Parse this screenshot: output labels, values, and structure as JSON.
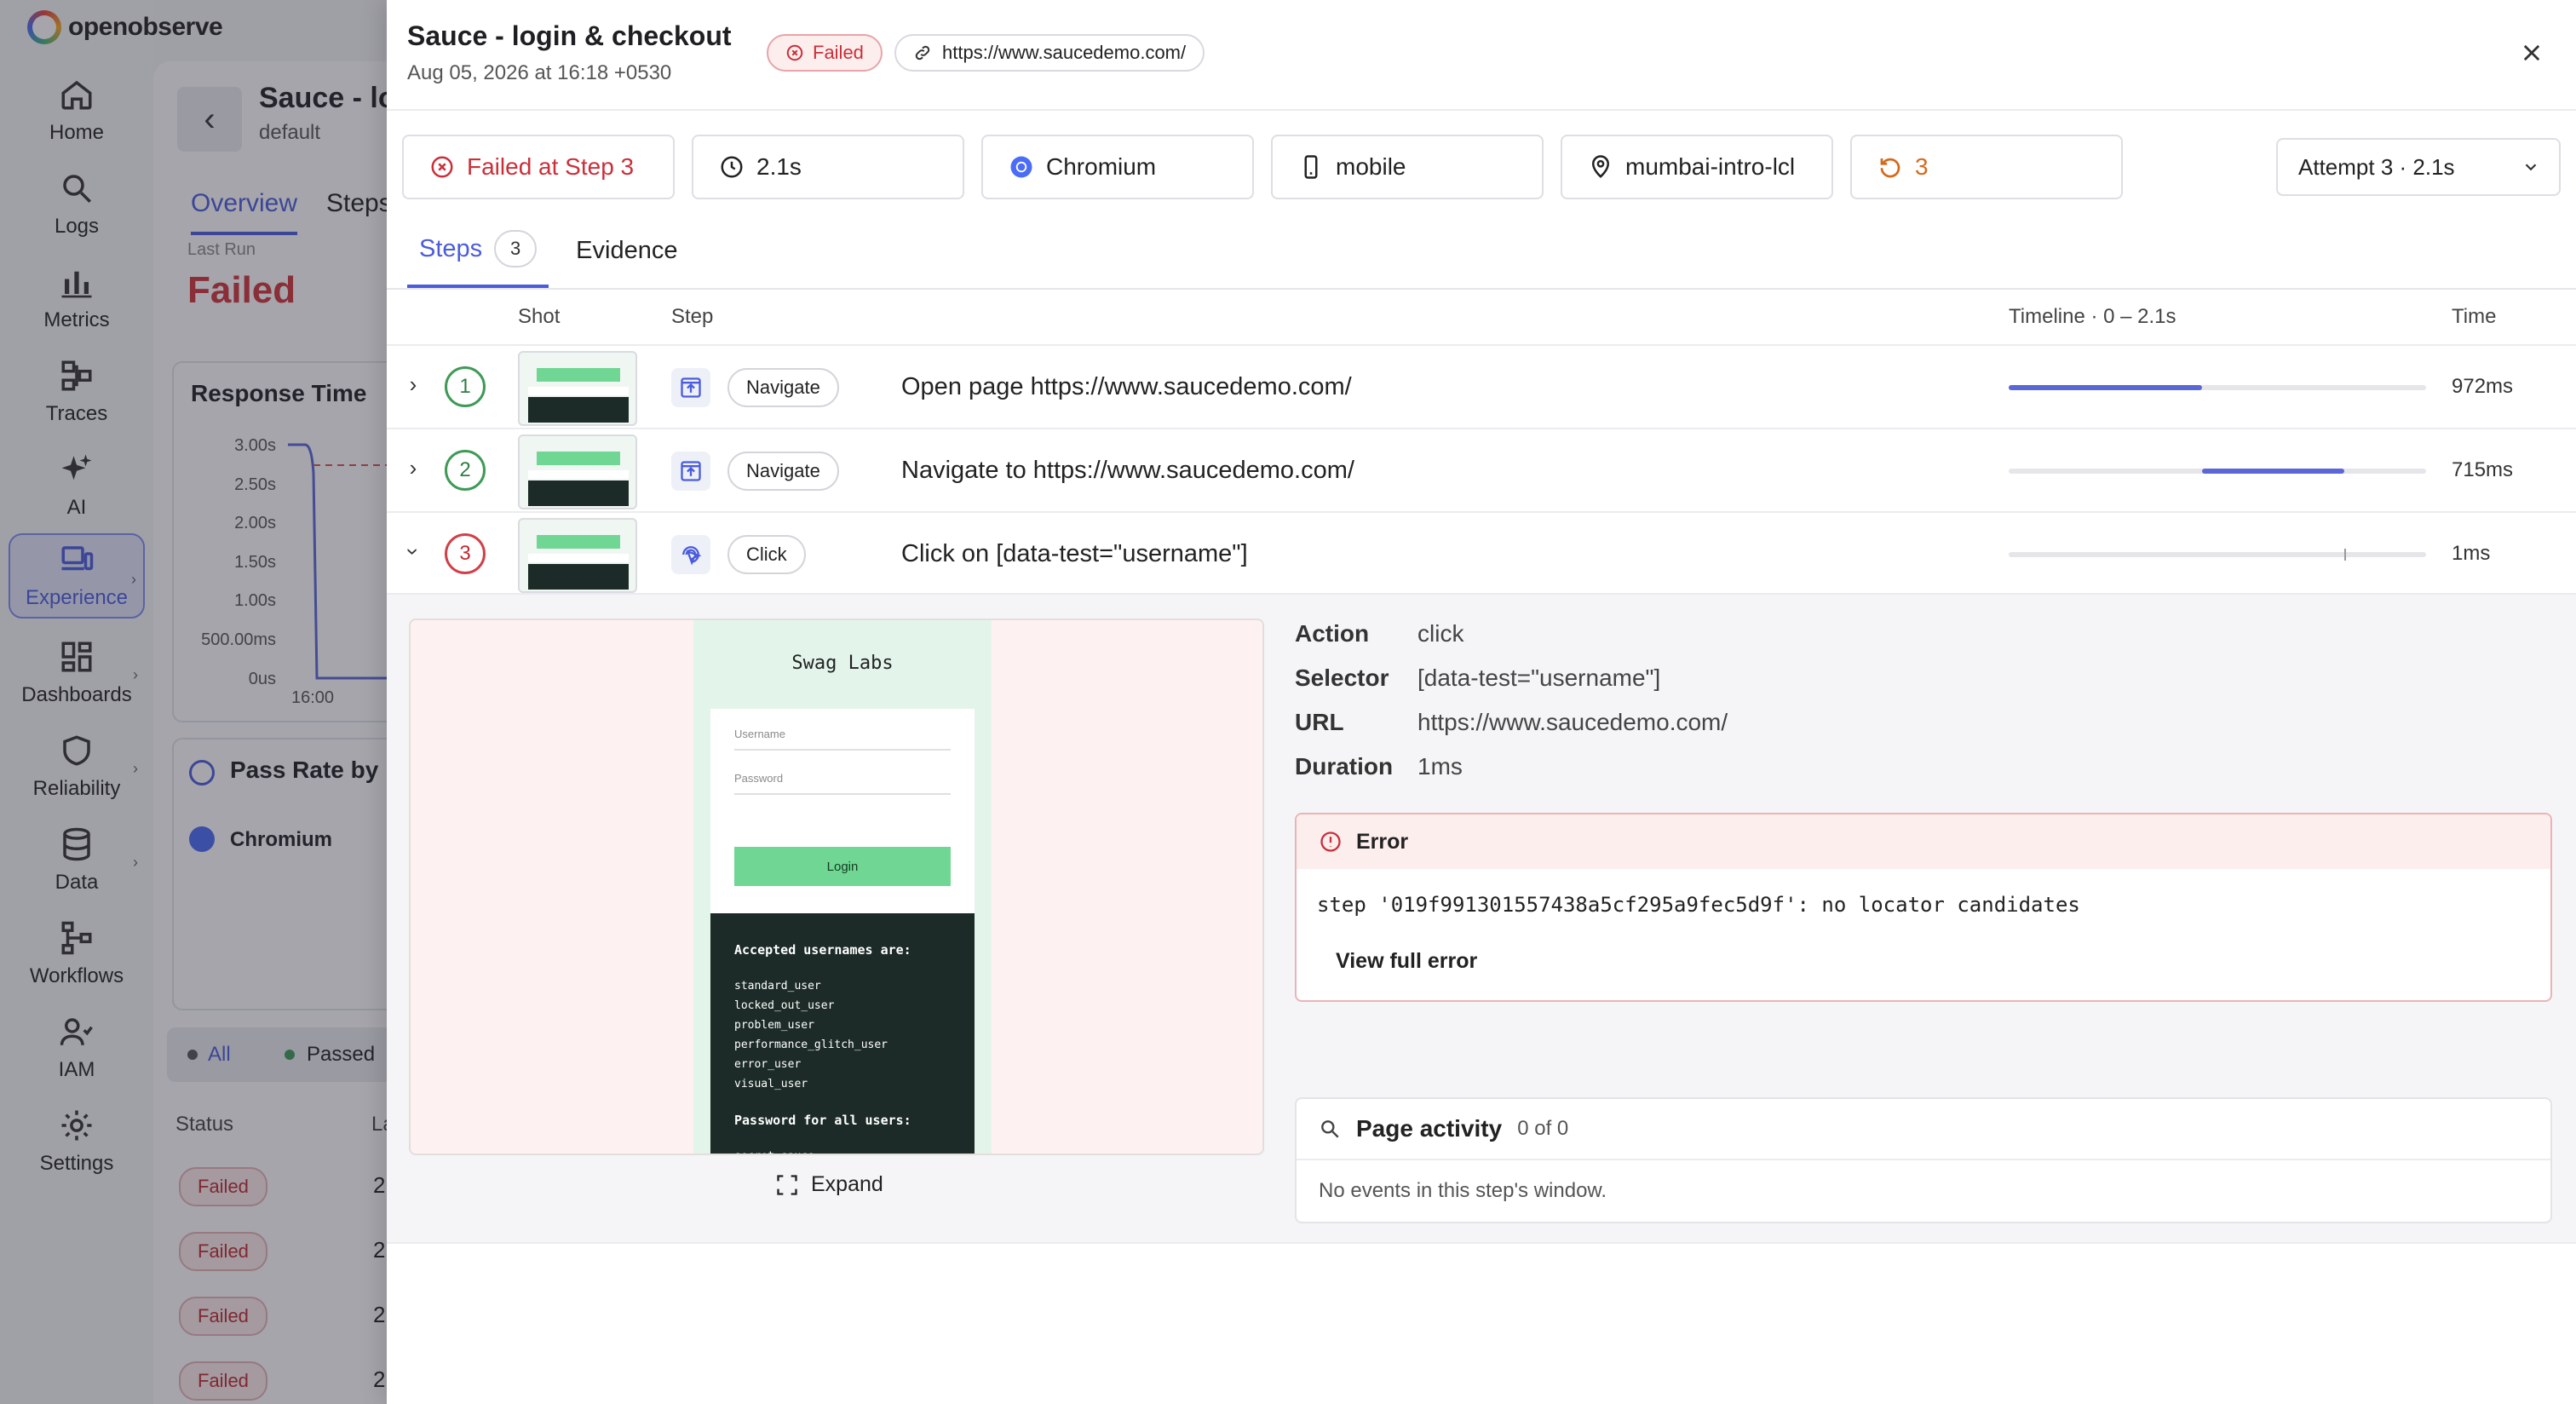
{
  "app": {
    "logo_text": "openobserve"
  },
  "nav": [
    {
      "label": "Home",
      "icon": "home-icon"
    },
    {
      "label": "Logs",
      "icon": "search-icon"
    },
    {
      "label": "Metrics",
      "icon": "bar-chart-icon"
    },
    {
      "label": "Traces",
      "icon": "traces-icon"
    },
    {
      "label": "AI",
      "icon": "sparkle-icon"
    },
    {
      "label": "Experience",
      "icon": "devices-icon",
      "active": true
    },
    {
      "label": "Dashboards",
      "icon": "dashboard-icon"
    },
    {
      "label": "Reliability",
      "icon": "shield-icon"
    },
    {
      "label": "Data",
      "icon": "database-icon"
    },
    {
      "label": "Workflows",
      "icon": "workflow-icon"
    },
    {
      "label": "IAM",
      "icon": "users-icon"
    },
    {
      "label": "Settings",
      "icon": "gear-icon"
    }
  ],
  "background": {
    "title": "Sauce - log",
    "subtitle": "default",
    "tabs": [
      "Overview",
      "Steps"
    ],
    "last_run_label": "Last Run",
    "last_run_value": "Failed",
    "response_card_title": "Response Time",
    "response_axis": [
      "3.00s",
      "2.50s",
      "2.00s",
      "1.50s",
      "1.00s",
      "500.00ms",
      "0us"
    ],
    "response_x_tick": "16:00",
    "pass_rate_title": "Pass Rate by I",
    "pass_rate_browser": "Chromium",
    "filters": [
      "All",
      "Passed"
    ],
    "status_header": "Status",
    "status_header_2": "La",
    "status_rows": [
      "Failed",
      "Failed",
      "Failed",
      "Failed"
    ],
    "status_row_suffix": "2"
  },
  "drawer": {
    "title": "Sauce - login & checkout",
    "date": "Aug 05, 2026 at 16:18 +0530",
    "status_badge": "Failed",
    "url_badge": "https://www.saucedemo.com/",
    "stats": {
      "failed_at": "Failed at Step 3",
      "duration": "2.1s",
      "browser": "Chromium",
      "device": "mobile",
      "location": "mumbai-intro-lcl",
      "retries": "3"
    },
    "attempt_select": "Attempt 3 · 2.1s",
    "tabs": {
      "steps": "Steps",
      "steps_count": "3",
      "evidence": "Evidence"
    },
    "table_headers": {
      "shot": "Shot",
      "step": "Step",
      "timeline": "Timeline · 0 – 2.1s",
      "time": "Time"
    },
    "steps": [
      {
        "num": "1",
        "status": "passed",
        "action": "Navigate",
        "desc": "Open page https://www.saucedemo.com/",
        "start_s": 0.0,
        "end_s": 0.972,
        "time": "972ms",
        "expanded": false
      },
      {
        "num": "2",
        "status": "passed",
        "action": "Navigate",
        "desc": "Navigate to https://www.saucedemo.com/",
        "start_s": 0.972,
        "end_s": 1.687,
        "time": "715ms",
        "expanded": false
      },
      {
        "num": "3",
        "status": "failed",
        "action": "Click",
        "desc": "Click on [data-test=\"username\"]",
        "start_s": 1.687,
        "end_s": 1.688,
        "time": "1ms",
        "expanded": true
      }
    ],
    "timeline_total_s": 2.1,
    "detail": {
      "screenshot": {
        "title": "Swag Labs",
        "username_placeholder": "Username",
        "password_placeholder": "Password",
        "login_button": "Login",
        "accepted_heading": "Accepted usernames are:",
        "usernames": [
          "standard_user",
          "locked_out_user",
          "problem_user",
          "performance_glitch_user",
          "error_user",
          "visual_user"
        ],
        "password_heading": "Password for all users:",
        "password_value": "secret_sauce"
      },
      "expand_label": "Expand",
      "fields": [
        {
          "key": "Action",
          "value": "click"
        },
        {
          "key": "Selector",
          "value": "[data-test=\"username\"]"
        },
        {
          "key": "URL",
          "value": "https://www.saucedemo.com/"
        },
        {
          "key": "Duration",
          "value": "1ms"
        }
      ],
      "error": {
        "title": "Error",
        "message": "step '019f991301557438a5cf295a9fec5d9f': no locator candidates",
        "button": "View full error"
      },
      "page_activity": {
        "title": "Page activity",
        "count": "0 of 0",
        "empty": "No events in this step's window."
      }
    }
  },
  "colors": {
    "accent": "#4a5cdc",
    "failed": "#c9303a",
    "passed": "#2f7d45",
    "retry": "#d46a1c"
  }
}
